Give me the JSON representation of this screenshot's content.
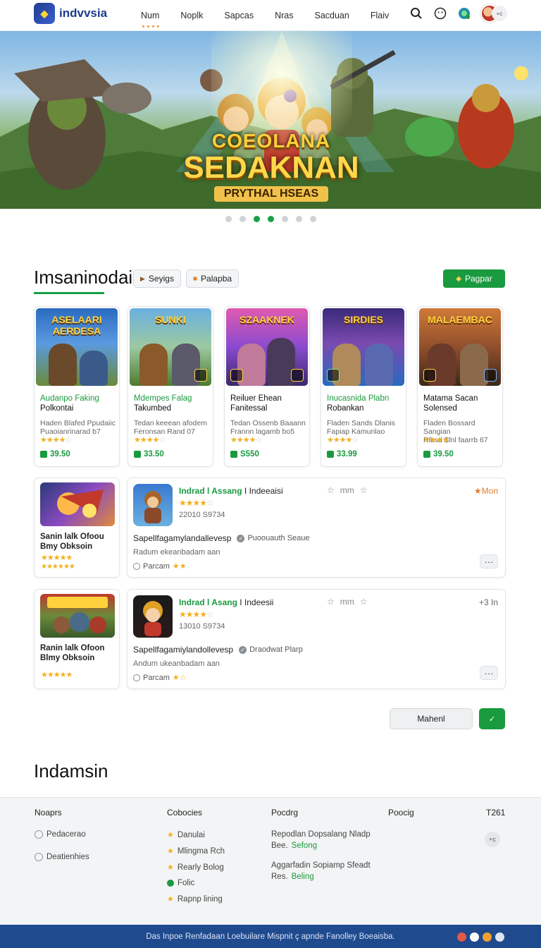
{
  "header": {
    "logo_text": "indvvsia",
    "nav": [
      "Num",
      "Noplk",
      "Sapcas",
      "Nras",
      "Sacduan",
      "Flaiv"
    ],
    "avatar_badge": "+c"
  },
  "hero": {
    "title_line1": "COEOLANA",
    "title_line2": "SEDAKNAN",
    "title_line3": "PRYTHAL HSEAS",
    "slide_count": 7,
    "active_slides": [
      2,
      3
    ]
  },
  "section": {
    "title": "Imsaninodai",
    "chip1": "Seyigs",
    "chip2": "Palapba",
    "action_button": "Pagpar"
  },
  "cards": [
    {
      "banner": "ASELAARI AERDESA",
      "name1": "Audanpo Faking",
      "name2": "Polkontai",
      "desc1": "Haden Blafed Ppudaiic",
      "desc2": "Puaoianrinarad b7",
      "stars": "★★★★",
      "empty": "☆",
      "price": "39.50"
    },
    {
      "banner": "SUNKI",
      "name1": "Mdempes Falag",
      "name2": "Takumbed",
      "desc1": "Tedan keeean afodem",
      "desc2": "Feronsan Rand 07",
      "stars": "★★★★",
      "empty": "☆",
      "price": "33.50"
    },
    {
      "banner": "SZAAKNEK",
      "name1": "Reiluer Ehean",
      "name2": "Fanitessal",
      "desc1": "Tedan Ossenb Baaann",
      "desc2": "Frannn lagamb bo5",
      "stars": "★★★★",
      "empty": "☆",
      "price": "S550"
    },
    {
      "banner": "SIRDIES",
      "name1": "Inucasnida Plabn",
      "name2": "Robankan",
      "desc1": "Fladen Sands Dlanis",
      "desc2": "Fapiap Kamunlao",
      "stars": "★★★★",
      "empty": "☆",
      "price": "33.99"
    },
    {
      "banner": "MALAEMBAC",
      "name1": "Matama Sacan",
      "name2": "Solensed",
      "desc1": "Fladen Bossard Sangian",
      "desc2": "Rlbsd $fnl faarrb 67",
      "stars": "★★★★",
      "empty": "☆",
      "price": "39.50"
    }
  ],
  "rows": [
    {
      "mini_name1": "Sanin lalk Ofoou",
      "mini_name2": "Bmy Obksoin",
      "mini_stars": [
        "★★★★★",
        "★★★★★★"
      ],
      "title_green": "Indrad l Assang",
      "title_dark": "I Indeeaisi",
      "rating": "★★★★",
      "rating_empty": "☆",
      "sub": "22010 S9734",
      "actions": "mm",
      "tag": "Mon",
      "tag_color": "#e07b2e",
      "desc": "Sapellfagamylandallevesp",
      "check_label": "Puoouauth Seaue",
      "line2": "Radum ekeanbadam aan",
      "line3": "Parcam",
      "line3_stars": "★★"
    },
    {
      "mini_name1": "Ranin lalk Ofoon",
      "mini_name2": "Blmy Obksoin",
      "mini_stars": [
        "★★★★★"
      ],
      "title_green": "Indrad l Asang",
      "title_dark": "I Indeesii",
      "rating": "★★★★",
      "rating_empty": "☆",
      "sub": "13010 S9734",
      "actions": "mm",
      "tag": "+3 In",
      "tag_color": "#666666",
      "desc": "Sapellfagamiylandollevesp",
      "check_label": "Draodwat Plarp",
      "line2": "Andum ukeanbadam aan",
      "line3": "Parcam",
      "line3_stars": "★☆"
    }
  ],
  "pager": {
    "more_button": "Mahenl",
    "go_button": "✓"
  },
  "section2": {
    "title": "Indamsin"
  },
  "footer": {
    "col1": {
      "title": "Noaprs",
      "items": [
        "Pedacerao",
        "Deatienhies"
      ]
    },
    "col2": {
      "title": "Cobocies",
      "items": [
        "Danulai",
        "Mlingma Rch",
        "Rearly Bolog",
        "Folic",
        "Rapnp lining"
      ]
    },
    "col3": {
      "title": "Pocdrg",
      "items": [
        [
          "Repodlan Dopsalang Nladp",
          "Bee.",
          "Sefong"
        ],
        [
          "Aggarfadin Sopiamp Sfeadt",
          "Res.",
          "Beling"
        ]
      ]
    },
    "col4": {
      "title": "Poocig"
    },
    "col5": {
      "title": "T261"
    },
    "pill": "+c"
  },
  "bottombar": {
    "text": "Das Inpoe Renfadaan Loebuilare Mispnit ç apnde Fanolley Boeaisba."
  },
  "colors": {
    "accent": "#1a9a3f",
    "brand": "#1c3b8a",
    "bar": "#1f4a8e"
  }
}
